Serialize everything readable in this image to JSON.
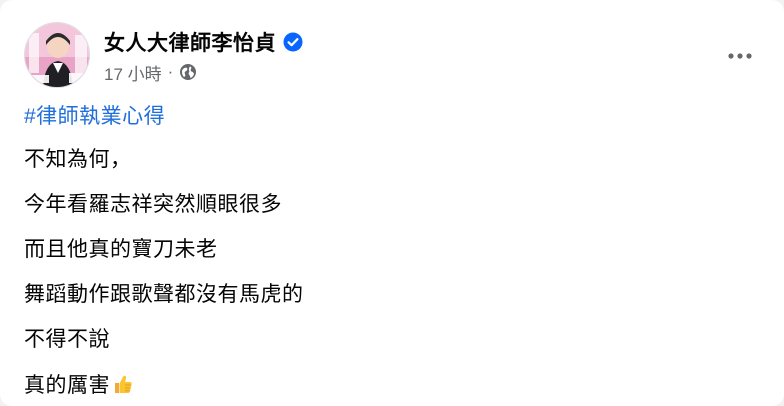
{
  "post": {
    "author": {
      "name": "女人大律師李怡貞",
      "verified": true,
      "avatar_icon": "profile-photo"
    },
    "timestamp": "17 小時",
    "separator": "·",
    "privacy_icon": "globe-icon",
    "menu_icon": "more-horizontal-icon",
    "hashtag": "#律師執業心得",
    "lines": [
      "不知為何，",
      "今年看羅志祥突然順眼很多",
      "而且他真的寶刀未老",
      "舞蹈動作跟歌聲都沒有馬虎的",
      "不得不說",
      "真的厲害"
    ],
    "trailing_emoji_icon": "thumbs-up-emoji"
  },
  "colors": {
    "link": "#216fdb",
    "verified": "#0866ff",
    "secondary_text": "#65676b",
    "primary_text": "#050505"
  }
}
